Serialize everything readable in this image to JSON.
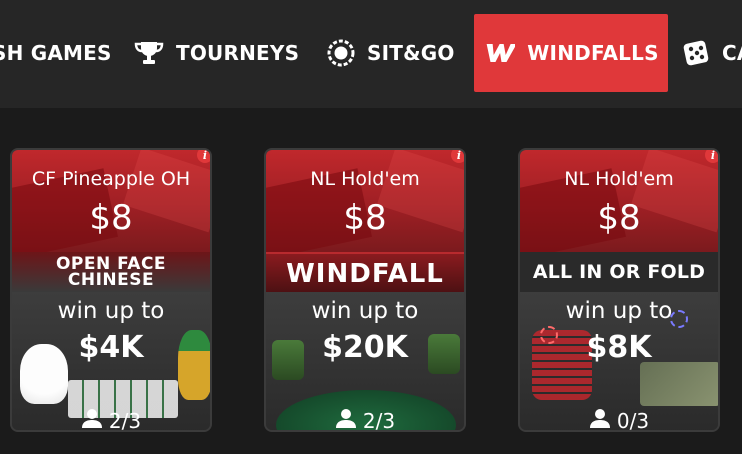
{
  "nav": {
    "tabs": [
      {
        "label": "SH GAMES",
        "icon": "cash-games-icon",
        "active": false
      },
      {
        "label": "TOURNEYS",
        "icon": "trophy-icon",
        "active": false
      },
      {
        "label": "SIT&GO",
        "icon": "target-icon",
        "active": false
      },
      {
        "label": "WINDFALLS",
        "icon": "windfall-w-icon",
        "active": true
      },
      {
        "label": "CA",
        "icon": "dice-icon",
        "active": false
      }
    ],
    "active_color": "#e0383a"
  },
  "cards": [
    {
      "game": "CF Pineapple OH",
      "buyin": "$8",
      "banner": "OPEN FACE\nCHINESE",
      "win_label": "win up to",
      "prize": "$4K",
      "players": "2/3",
      "info": "i"
    },
    {
      "game": "NL Hold'em",
      "buyin": "$8",
      "banner": "WINDFALL",
      "win_label": "win up to",
      "prize": "$20K",
      "players": "2/3",
      "info": "i"
    },
    {
      "game": "NL Hold'em",
      "buyin": "$8",
      "banner": "ALL IN OR FOLD",
      "win_label": "win up to",
      "prize": "$8K",
      "players": "0/3",
      "info": "i"
    }
  ]
}
